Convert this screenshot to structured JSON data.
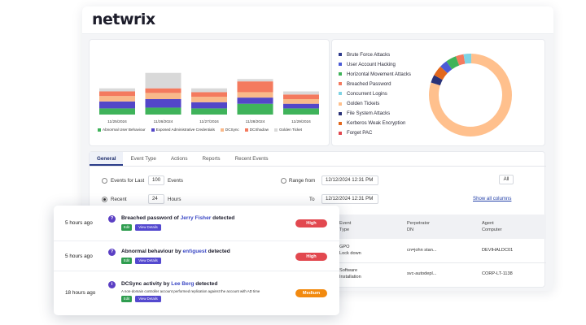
{
  "brand": {
    "logo": "netwrix"
  },
  "chart_data": [
    {
      "type": "bar",
      "stacked": true,
      "categories": [
        "11/25/2024",
        "11/26/2024",
        "11/27/2024",
        "11/28/2024",
        "11/29/2024"
      ],
      "series": [
        {
          "name": "Abnormal User Behaviour",
          "color": "#3fb35a",
          "values": [
            8,
            9,
            8,
            14,
            8
          ]
        },
        {
          "name": "Exposed Administrative Credentials",
          "color": "#5346c8",
          "values": [
            9,
            11,
            8,
            8,
            6
          ]
        },
        {
          "name": "DCSync",
          "color": "#f9b98a",
          "values": [
            7,
            8,
            7,
            7,
            6
          ]
        },
        {
          "name": "DCShadow",
          "color": "#f47a5e",
          "values": [
            6,
            6,
            6,
            14,
            6
          ]
        },
        {
          "name": "Golden Ticket",
          "color": "#d9d9d9",
          "values": [
            4,
            20,
            5,
            3,
            4
          ]
        }
      ],
      "legend": "bottom",
      "grid": false
    },
    {
      "type": "pie",
      "donut": true,
      "labels": [
        "Brute Force Attacks",
        "User Account Hacking",
        "Horizontal Movement Attacks",
        "Breached Password",
        "Concurrent Logins",
        "Golden Tickets",
        "File System Attacks",
        "Kerberos Weak Encryption",
        "Forget PAC"
      ],
      "colors": [
        "#2e3a8c",
        "#4b5bd6",
        "#3fb35a",
        "#f47a5e",
        "#7fd3e4",
        "#ffc08d",
        "#2a3278",
        "#e2671c",
        "#e2484f"
      ],
      "values": [
        0,
        3,
        4,
        3,
        3,
        78,
        3,
        4,
        0
      ],
      "legend": "left"
    }
  ],
  "tabs": [
    {
      "label": "General",
      "active": true
    },
    {
      "label": "Event Type",
      "active": false
    },
    {
      "label": "Actions",
      "active": false
    },
    {
      "label": "Reports",
      "active": false
    },
    {
      "label": "Recent Events",
      "active": false
    }
  ],
  "filters": {
    "events_for_last_label": "Events for Last",
    "events_count": "100",
    "events_unit": "Events",
    "recent_label": "Recent",
    "recent_value": "24",
    "recent_unit": "Hours",
    "range_from_label": "Range from",
    "range_from_value": "12/12/2024 12:31 PM",
    "to_label": "To",
    "to_value": "12/12/2024 12:31 PM",
    "all_button": "All",
    "show_all_columns": "Show all columns"
  },
  "events_table": {
    "headers": [
      {
        "line1": "Event",
        "line2": "Type"
      },
      {
        "line1": "Perpetrator",
        "line2": "DN"
      },
      {
        "line1": "Agent",
        "line2": "Computer"
      }
    ],
    "rows": [
      {
        "type1": "GPO",
        "type2": "Lock down",
        "dn": "cn=john stan...",
        "computer": "DEVIHALDC01"
      },
      {
        "type1": "Software",
        "type2": "Installation",
        "dn": "svc-autodepl...",
        "computer": "CORP-LT-1138"
      }
    ]
  },
  "alerts": [
    {
      "time": "5 hours ago",
      "icon": "?",
      "title_pre": "Breached password of ",
      "title_hl": "Jerry Fisher",
      "title_post": " detected",
      "subtitle": "",
      "edit": "Edit",
      "view": "View Details",
      "severity": "High"
    },
    {
      "time": "5 hours ago",
      "icon": "?",
      "title_pre": "Abnormal behaviour by ",
      "title_hl": "ent\\guest",
      "title_post": " detected",
      "subtitle": "",
      "edit": "Edit",
      "view": "View Details",
      "severity": "High"
    },
    {
      "time": "18 hours ago",
      "icon": "i",
      "title_pre": "DCSync activity by ",
      "title_hl": "Lee Berg",
      "title_post": " detected",
      "subtitle": "A non-domain controller account performed replication against the account with AD time",
      "edit": "Edit",
      "view": "View Details",
      "severity": "Medium"
    }
  ]
}
